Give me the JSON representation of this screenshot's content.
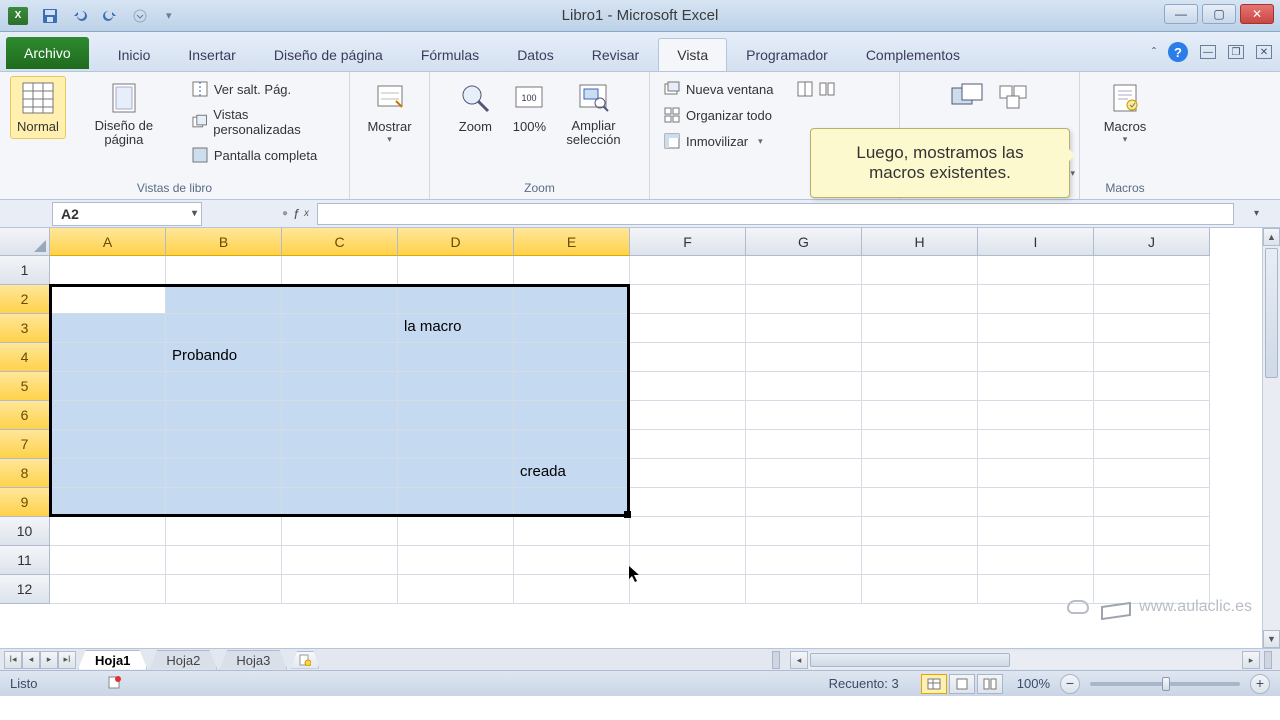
{
  "window": {
    "title": "Libro1 - Microsoft Excel"
  },
  "tabs": {
    "file": "Archivo",
    "items": [
      "Inicio",
      "Insertar",
      "Diseño de página",
      "Fórmulas",
      "Datos",
      "Revisar",
      "Vista",
      "Programador",
      "Complementos"
    ],
    "active_index": 6
  },
  "ribbon": {
    "views": {
      "normal": "Normal",
      "page_layout": "Diseño de página",
      "page_break": "Ver salt. Pág.",
      "custom_views": "Vistas personalizadas",
      "full_screen": "Pantalla completa",
      "group_label": "Vistas de libro"
    },
    "show_group": {
      "button": "Mostrar"
    },
    "zoom": {
      "zoom": "Zoom",
      "hundred": "100%",
      "to_selection_l1": "Ampliar",
      "to_selection_l2": "selección",
      "group_label": "Zoom"
    },
    "window": {
      "new_window": "Nueva ventana",
      "arrange_all": "Organizar todo",
      "freeze": "Inmovilizar"
    },
    "macros": {
      "button": "Macros",
      "group_label": "Macros"
    }
  },
  "balloon": {
    "line1": "Luego, mostramos las",
    "line2": "macros existentes."
  },
  "namebox": "A2",
  "columns": [
    "A",
    "B",
    "C",
    "D",
    "E",
    "F",
    "G",
    "H",
    "I",
    "J"
  ],
  "selected_cols": [
    "A",
    "B",
    "C",
    "D",
    "E"
  ],
  "rows": [
    "1",
    "2",
    "3",
    "4",
    "5",
    "6",
    "7",
    "8",
    "9",
    "10",
    "11",
    "12"
  ],
  "selected_rows": [
    "2",
    "3",
    "4",
    "5",
    "6",
    "7",
    "8",
    "9"
  ],
  "cells": {
    "B4": "Probando",
    "D3": "la macro",
    "E8": "creada"
  },
  "sheets": {
    "items": [
      "Hoja1",
      "Hoja2",
      "Hoja3"
    ],
    "active_index": 0
  },
  "status": {
    "ready": "Listo",
    "count_label": "Recuento: 3",
    "zoom": "100%"
  },
  "watermark": "www.aulaclic.es"
}
